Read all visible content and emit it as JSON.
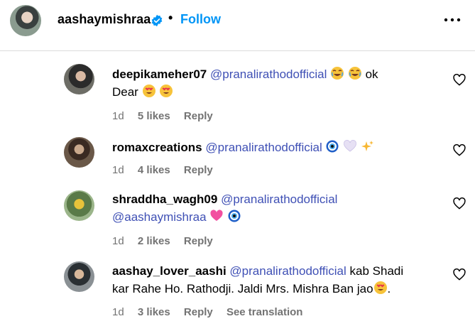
{
  "header": {
    "username": "aashaymishraa",
    "separator": "•",
    "follow_label": "Follow",
    "more_icon": "more-horizontal-icon",
    "verified_icon": "verified-badge-icon"
  },
  "comments": [
    {
      "username": "deepikameher07",
      "mention": "@pranalirathodofficial",
      "text_after": "ok",
      "text_line2": "Dear",
      "time": "1d",
      "likes": "5 likes",
      "reply": "Reply"
    },
    {
      "username": "romaxcreations",
      "mention": "@pranalirathodofficial",
      "time": "1d",
      "likes": "4 likes",
      "reply": "Reply"
    },
    {
      "username": "shraddha_wagh09",
      "mention": "@pranalirathodofficial",
      "mention2": "@aashaymishraa",
      "time": "1d",
      "likes": "2 likes",
      "reply": "Reply"
    },
    {
      "username": "aashay_lover_aashi",
      "mention": "@pranalirathodofficial",
      "text_after": "kab Shadi",
      "text_line2": "kar Rahe Ho. Rathodji. Jaldi Mrs. Mishra Ban jao",
      "text_end": ".",
      "time": "1d",
      "likes": "3 likes",
      "reply": "Reply",
      "see_translation": "See translation"
    }
  ],
  "colors": {
    "follow": "#0095f6",
    "mention": "#3f50b5",
    "meta": "#737373",
    "divider": "#dbdbdb"
  }
}
